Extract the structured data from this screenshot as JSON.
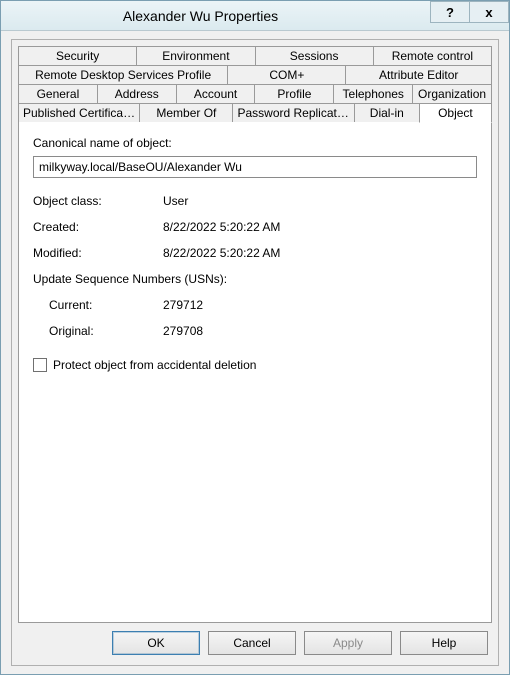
{
  "window": {
    "title": "Alexander Wu Properties",
    "help_btn": "?",
    "close_btn": "x"
  },
  "tabs": {
    "row1": [
      "Security",
      "Environment",
      "Sessions",
      "Remote control"
    ],
    "row2": [
      "Remote Desktop Services Profile",
      "COM+",
      "Attribute Editor"
    ],
    "row3": [
      "General",
      "Address",
      "Account",
      "Profile",
      "Telephones",
      "Organization"
    ],
    "row4": [
      "Published Certificates",
      "Member Of",
      "Password Replication",
      "Dial-in",
      "Object"
    ],
    "active": "Object"
  },
  "object": {
    "canonical_label": "Canonical name of object:",
    "canonical_value": "milkyway.local/BaseOU/Alexander Wu",
    "class_label": "Object class:",
    "class_value": "User",
    "created_label": "Created:",
    "created_value": "8/22/2022 5:20:22 AM",
    "modified_label": "Modified:",
    "modified_value": "8/22/2022 5:20:22 AM",
    "usn_header": "Update Sequence Numbers (USNs):",
    "usn_current_label": "Current:",
    "usn_current_value": "279712",
    "usn_original_label": "Original:",
    "usn_original_value": "279708",
    "protect_label": "Protect object from accidental deletion",
    "protect_checked": false
  },
  "buttons": {
    "ok": "OK",
    "cancel": "Cancel",
    "apply": "Apply",
    "help": "Help"
  }
}
